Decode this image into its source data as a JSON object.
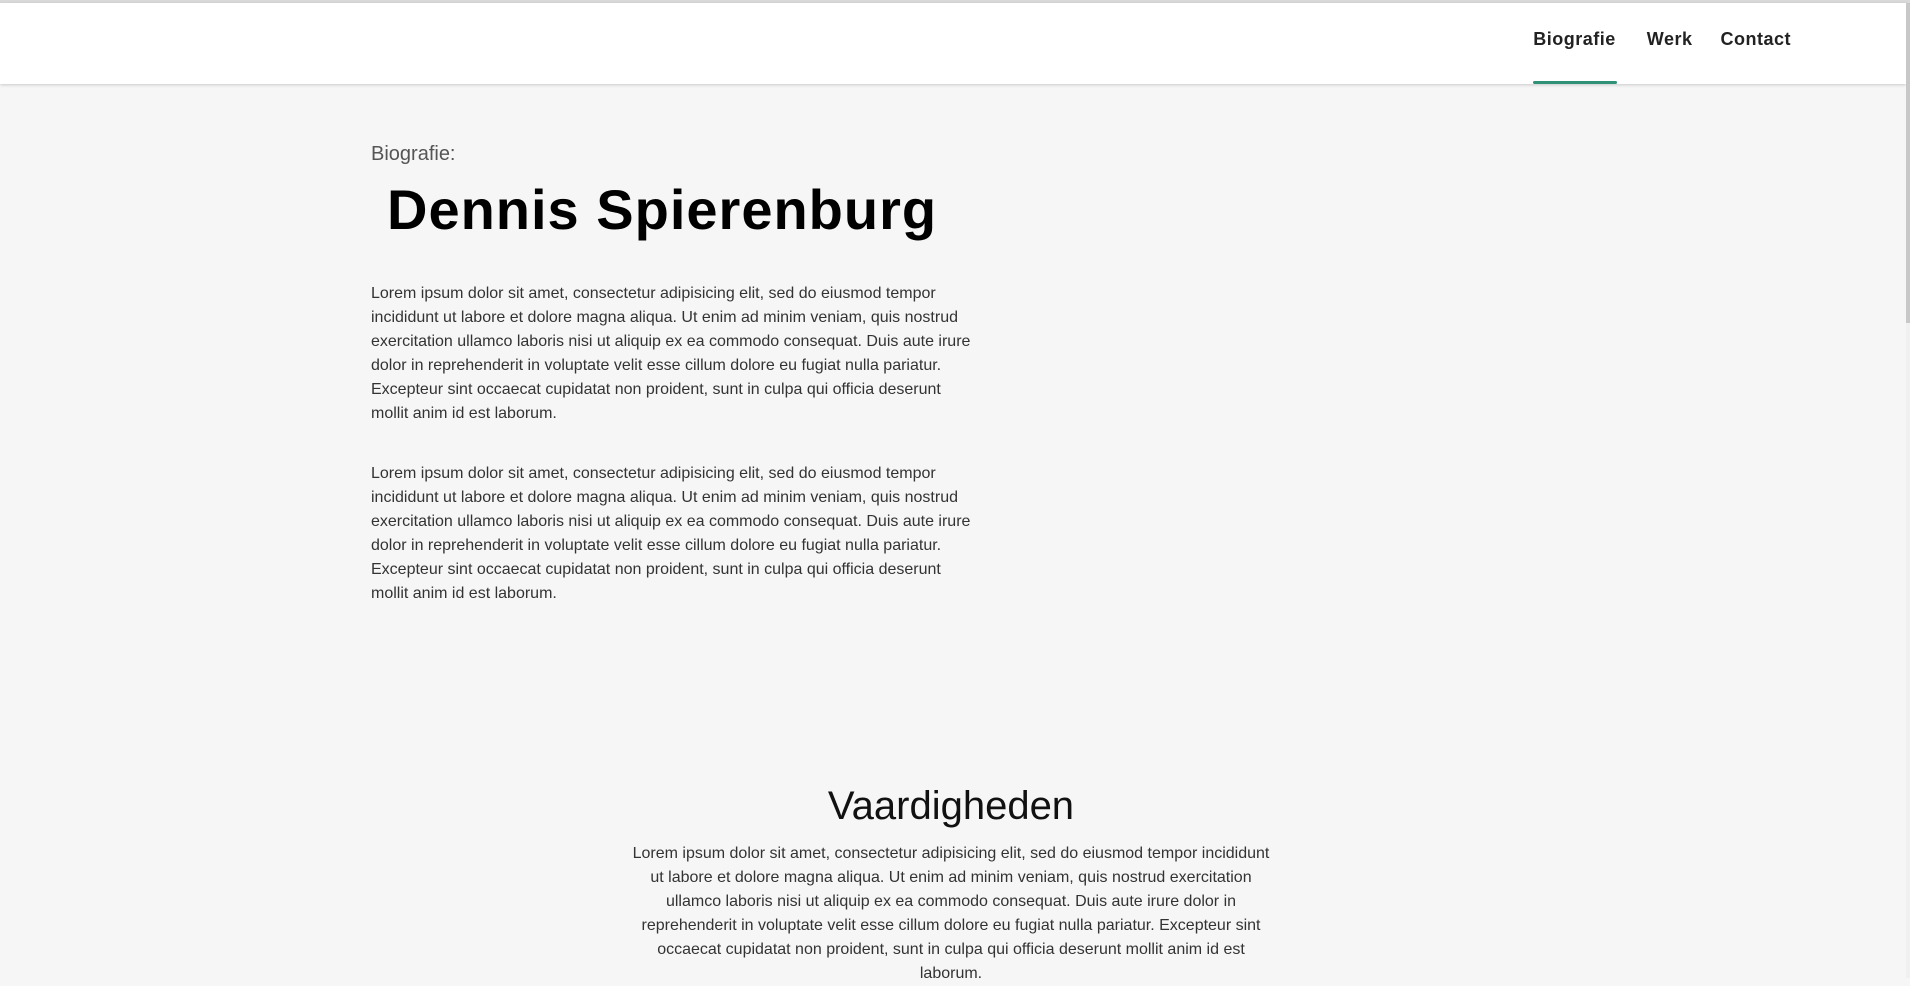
{
  "nav": {
    "items": [
      {
        "label": "Biografie",
        "active": true
      },
      {
        "label": "Werk",
        "active": false
      },
      {
        "label": "Contact",
        "active": false
      }
    ]
  },
  "bio": {
    "kicker": "Biografie:",
    "name": "Dennis Spierenburg",
    "paragraphs": [
      "Lorem ipsum dolor sit amet, consectetur adipisicing elit, sed do eiusmod tempor incididunt ut labore et dolore magna aliqua. Ut enim ad minim veniam, quis nostrud exercitation ullamco laboris nisi ut aliquip ex ea commodo consequat. Duis aute irure dolor in reprehenderit in voluptate velit esse cillum dolore eu fugiat nulla pariatur. Excepteur sint occaecat cupidatat non proident, sunt in culpa qui officia deserunt mollit anim id est laborum.",
      "Lorem ipsum dolor sit amet, consectetur adipisicing elit, sed do eiusmod tempor incididunt ut labore et dolore magna aliqua. Ut enim ad minim veniam, quis nostrud exercitation ullamco laboris nisi ut aliquip ex ea commodo consequat. Duis aute irure dolor in reprehenderit in voluptate velit esse cillum dolore eu fugiat nulla pariatur. Excepteur sint occaecat cupidatat non proident, sunt in culpa qui officia deserunt mollit anim id est laborum."
    ]
  },
  "skills": {
    "title": "Vaardigheden",
    "paragraph": "Lorem ipsum dolor sit amet, consectetur adipisicing elit, sed do eiusmod tempor incididunt ut labore et dolore magna aliqua. Ut enim ad minim veniam, quis nostrud exercitation ullamco laboris nisi ut aliquip ex ea commodo consequat. Duis aute irure dolor in reprehenderit in voluptate velit esse cillum dolore eu fugiat nulla pariatur. Excepteur sint occaecat cupidatat non proident, sunt in culpa qui officia deserunt mollit anim id est laborum."
  },
  "colors": {
    "accent": "#2f9178",
    "background": "#f6f6f6",
    "header": "#ffffff"
  }
}
